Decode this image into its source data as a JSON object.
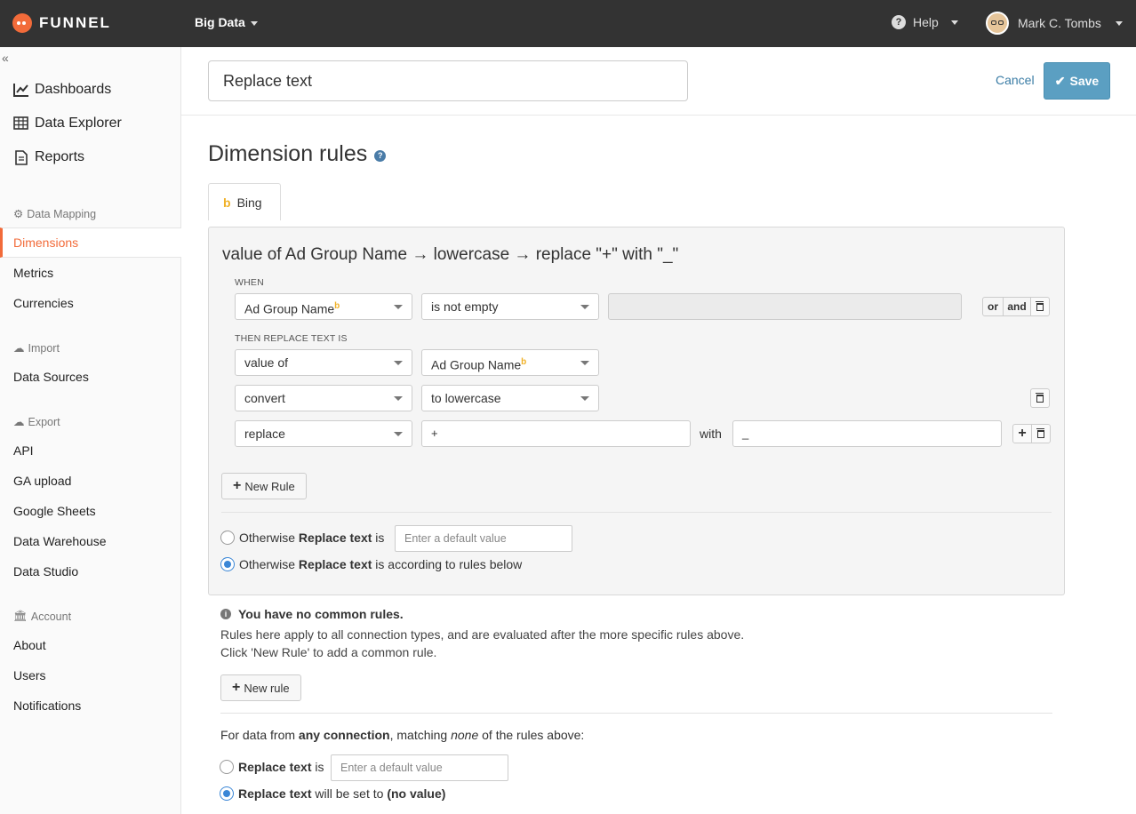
{
  "topbar": {
    "brand": "FUNNEL",
    "workspace": "Big Data",
    "help": "Help",
    "user": "Mark C. Tombs"
  },
  "sidebar": {
    "collapse": "«",
    "main_items": [
      "Dashboards",
      "Data Explorer",
      "Reports"
    ],
    "sections": [
      {
        "title": "Data Mapping",
        "items": [
          "Dimensions",
          "Metrics",
          "Currencies"
        ]
      },
      {
        "title": "Import",
        "items": [
          "Data Sources"
        ]
      },
      {
        "title": "Export",
        "items": [
          "API",
          "GA upload",
          "Google Sheets",
          "Data Warehouse",
          "Data Studio"
        ]
      },
      {
        "title": "Account",
        "items": [
          "About",
          "Users",
          "Notifications"
        ]
      }
    ],
    "active": "Dimensions"
  },
  "header": {
    "name_value": "Replace text",
    "cancel": "Cancel",
    "save": "Save"
  },
  "page": {
    "title": "Dimension rules",
    "tab": "Bing"
  },
  "rule": {
    "summary": "value of Ad Group Name → lowercase → replace \"+\" with \"_\"",
    "when_label": "WHEN",
    "when_field": "Ad Group Name",
    "when_op": "is not empty",
    "or": "or",
    "and": "and",
    "then_label": "THEN REPLACE TEXT IS",
    "row1_op": "value of",
    "row1_field": "Ad Group Name",
    "row2_op": "convert",
    "row2_value": "to lowercase",
    "row3_op": "replace",
    "row3_find": "+",
    "with_label": "with",
    "row3_replace": "_",
    "new_rule": "New Rule",
    "otherwise1_a": "Otherwise ",
    "otherwise1_b": "Replace text",
    "otherwise1_c": " is",
    "default_placeholder": "Enter a default value",
    "otherwise2_a": "Otherwise ",
    "otherwise2_b": "Replace text",
    "otherwise2_c": " is according to rules below"
  },
  "common": {
    "heading": "You have no common rules.",
    "line1": "Rules here apply to all connection types, and are evaluated after the more specific rules above.",
    "line2": "Click 'New Rule' to add a common rule.",
    "new_rule": "New rule"
  },
  "fallback": {
    "text_a": "For data from ",
    "text_b": "any connection",
    "text_c": ", matching ",
    "text_d": "none",
    "text_e": " of the rules above:",
    "opt1_b": "Replace text",
    "opt1_c": " is",
    "placeholder": "Enter a default value",
    "opt2_b": "Replace text",
    "opt2_c": " will be set to ",
    "opt2_d": "(no value)"
  },
  "colors": {
    "accent": "#f26b3a",
    "topbar": "#333333",
    "save": "#5b9fc2",
    "link": "#3a7ca5",
    "bing": "#f0b128",
    "radio": "#3a86d6"
  }
}
